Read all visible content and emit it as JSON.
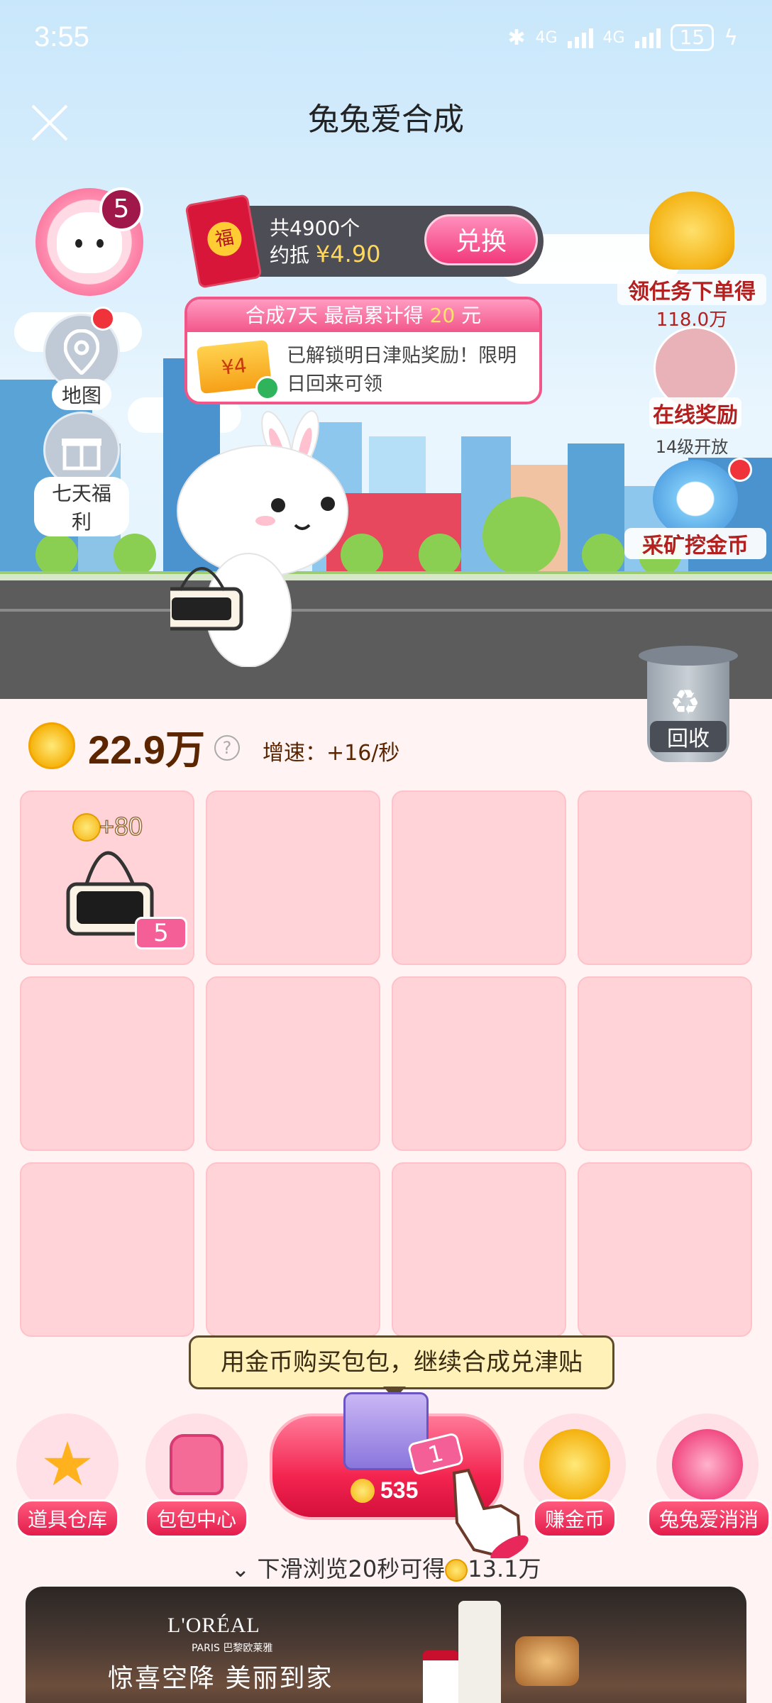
{
  "status_bar": {
    "time": "3:55",
    "network1": "4G",
    "network2": "4G",
    "battery": "15"
  },
  "header": {
    "title": "兔兔爱合成"
  },
  "avatar": {
    "badge": "5"
  },
  "left_menu": [
    {
      "label": "地图"
    },
    {
      "label": "七天福利"
    }
  ],
  "exchange": {
    "total": "共4900个",
    "approx_label": "约抵",
    "amount": "¥4.90",
    "button": "兑换",
    "packet_char": "福"
  },
  "reward_card": {
    "header_prefix": "合成7天 最高累计得",
    "header_amount": "20",
    "header_suffix": "元",
    "ticket": "¥4",
    "message": "已解锁明日津贴奖励！限明日回来可领"
  },
  "right_menu": {
    "task_label": "领任务下单得",
    "task_value": "118.0万",
    "online_label": "在线奖励",
    "mine_note": "14级开放",
    "mine_label": "采矿挖金币"
  },
  "recycle": {
    "label": "回收"
  },
  "balance": {
    "value": "22.9万",
    "help": "?",
    "speed": "增速：+16/秒"
  },
  "grid_item": {
    "plus": "+80",
    "level": "5"
  },
  "tooltip": {
    "text": "用金币购买包包，继续合成兑津贴"
  },
  "bottom_bar": {
    "items": [
      {
        "label": "道具仓库"
      },
      {
        "label": "包包中心"
      },
      {
        "label": "赚金币"
      },
      {
        "label": "兔兔爱消消"
      }
    ],
    "buy_price": "535",
    "buy_level": "1"
  },
  "scroll_hint": {
    "prefix": "下滑浏览20秒可得",
    "reward": "13.1万"
  },
  "ad": {
    "brand": "L'ORÉAL",
    "sub": "PARIS 巴黎欧莱雅",
    "slogan": "惊喜空降 美丽到家"
  },
  "colors": {
    "accent": "#f25689",
    "scene_sky": "#c9e7fb",
    "cell": "#ffd3d8",
    "coin": "#f6b40e"
  }
}
